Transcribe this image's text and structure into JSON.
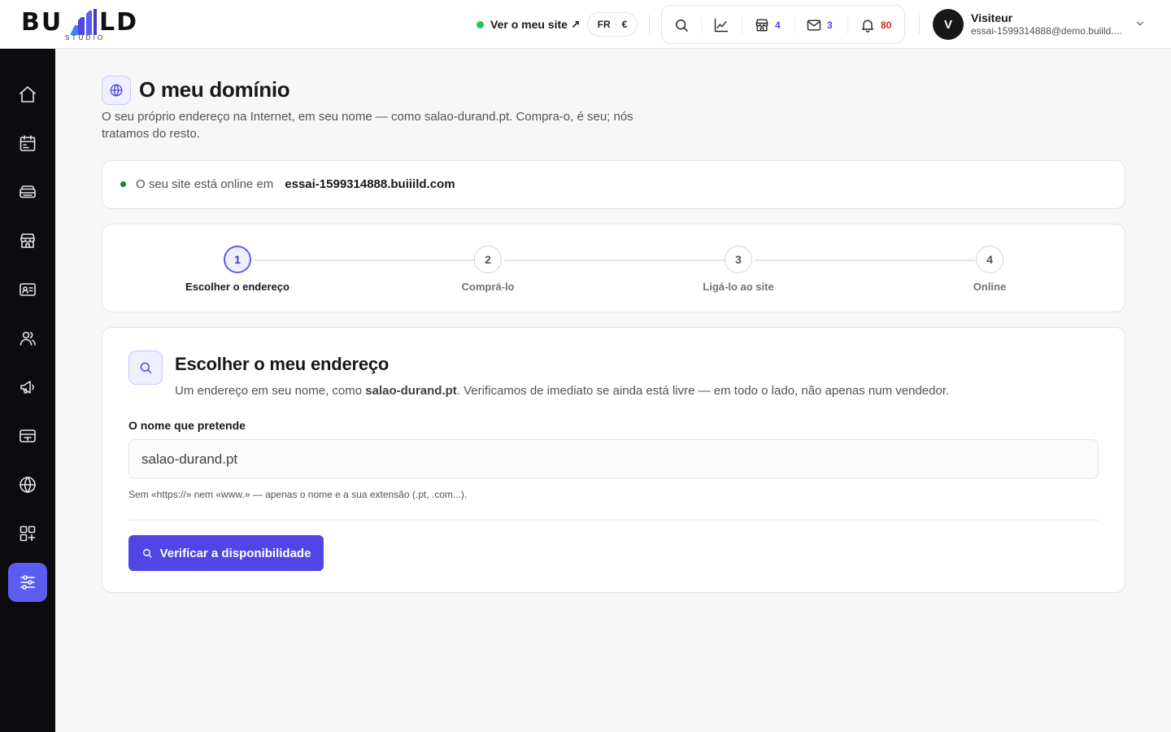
{
  "brand": {
    "logo_left": "BU",
    "logo_right": "LD",
    "logo_sub": "STUDIO",
    "accent": "#5b5cf0",
    "button_color": "#4f46e5"
  },
  "topbar": {
    "site_link": "Ver o meu site ↗",
    "lang": "FR",
    "currency": "€",
    "tools": [
      {
        "icon": "search-icon",
        "count": null
      },
      {
        "icon": "chart-icon",
        "count": null
      },
      {
        "icon": "store-icon",
        "count": "4"
      },
      {
        "icon": "mail-icon",
        "count": "3"
      },
      {
        "icon": "bell-icon",
        "count": "80"
      }
    ],
    "user": {
      "initial": "V",
      "name": "Visiteur",
      "email": "essai-1599314888@demo.buiild...."
    }
  },
  "sidebar": {
    "items": [
      {
        "icon": "home-icon",
        "active": false
      },
      {
        "icon": "calendar-icon",
        "active": false
      },
      {
        "icon": "inbox-icon",
        "active": false
      },
      {
        "icon": "store-icon",
        "active": false
      },
      {
        "icon": "contact-card-icon",
        "active": false
      },
      {
        "icon": "users-icon",
        "active": false
      },
      {
        "icon": "megaphone-icon",
        "active": false
      },
      {
        "icon": "payment-icon",
        "active": false
      },
      {
        "icon": "globe-icon",
        "active": false
      },
      {
        "icon": "apps-icon",
        "active": false
      },
      {
        "icon": "sliders-icon",
        "active": true
      }
    ]
  },
  "page": {
    "title": "O meu domínio",
    "description": "O seu próprio endereço na Internet, em seu nome — como salao-durand.pt. Compra-o, é seu; nós tratamos do resto."
  },
  "status": {
    "text": "O seu site está online em",
    "url": "essai-1599314888.buiiild.com"
  },
  "steps": [
    {
      "number": "1",
      "label": "Escolher o endereço",
      "active": true
    },
    {
      "number": "2",
      "label": "Comprá-lo",
      "active": false
    },
    {
      "number": "3",
      "label": "Ligá-lo ao site",
      "active": false
    },
    {
      "number": "4",
      "label": "Online",
      "active": false
    }
  ],
  "form": {
    "title": "Escolher o meu endereço",
    "desc_before": "Um endereço em seu nome, como ",
    "desc_bold": "salao-durand.pt",
    "desc_after": ". Verificamos de imediato se ainda está livre — em todo o lado, não apenas num vendedor.",
    "field_label": "O nome que pretende",
    "field_value": "salao-durand.pt",
    "hint": "Sem «https://» nem «www.» — apenas o nome e a sua extensão (.pt, .com...).",
    "button_label": "Verificar a disponibilidade"
  }
}
